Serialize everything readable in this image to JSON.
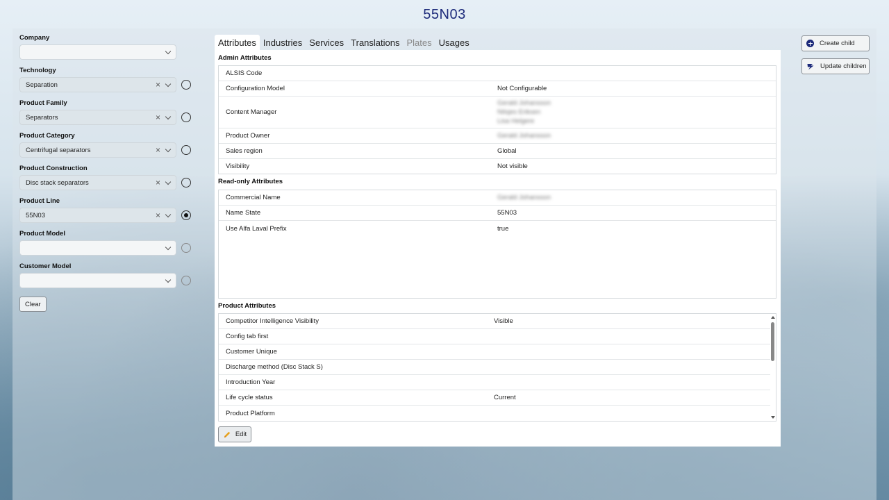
{
  "page": {
    "title": "55N03"
  },
  "filters": [
    {
      "label": "Company",
      "value": "",
      "clearable": false,
      "radio": "none"
    },
    {
      "label": "Technology",
      "value": "Separation",
      "clearable": true,
      "radio": "unchecked"
    },
    {
      "label": "Product Family",
      "value": "Separators",
      "clearable": true,
      "radio": "unchecked"
    },
    {
      "label": "Product Category",
      "value": "Centrifugal separators",
      "clearable": true,
      "radio": "unchecked"
    },
    {
      "label": "Product Construction",
      "value": "Disc stack separators",
      "clearable": true,
      "radio": "unchecked"
    },
    {
      "label": "Product Line",
      "value": "55N03",
      "clearable": true,
      "radio": "checked"
    },
    {
      "label": "Product Model",
      "value": "",
      "clearable": false,
      "radio": "dim"
    },
    {
      "label": "Customer Model",
      "value": "",
      "clearable": false,
      "radio": "dim"
    }
  ],
  "clear_label": "Clear",
  "tabs": [
    {
      "label": "Attributes",
      "state": "active"
    },
    {
      "label": "Industries",
      "state": "normal"
    },
    {
      "label": "Services",
      "state": "normal"
    },
    {
      "label": "Translations",
      "state": "normal"
    },
    {
      "label": "Plates",
      "state": "disabled"
    },
    {
      "label": "Usages",
      "state": "normal"
    }
  ],
  "admin": {
    "title": "Admin Attributes",
    "rows": [
      {
        "key": "ALSIS Code",
        "value": ""
      },
      {
        "key": "Configuration Model",
        "value": "Not Configurable"
      },
      {
        "key": "Content Manager",
        "value": "",
        "blurred_lines": 3
      },
      {
        "key": "Product Owner",
        "value": "",
        "blurred_lines": 1
      },
      {
        "key": "Sales region",
        "value": "Global"
      },
      {
        "key": "Visibility",
        "value": "Not visible"
      }
    ]
  },
  "readonly": {
    "title": "Read-only Attributes",
    "rows": [
      {
        "key": "Commercial Name",
        "value": "",
        "blurred_lines": 1
      },
      {
        "key": "Name State",
        "value": "55N03"
      },
      {
        "key": "Use Alfa Laval Prefix",
        "value": "true"
      }
    ]
  },
  "product": {
    "title": "Product Attributes",
    "rows": [
      {
        "key": "Competitor Intelligence Visibility",
        "value": "Visible"
      },
      {
        "key": "Config tab first",
        "value": ""
      },
      {
        "key": "Customer Unique",
        "value": ""
      },
      {
        "key": "Discharge method (Disc Stack S)",
        "value": ""
      },
      {
        "key": "Introduction Year",
        "value": ""
      },
      {
        "key": "Life cycle status",
        "value": "Current"
      },
      {
        "key": "Product Platform",
        "value": ""
      }
    ]
  },
  "edit_label": "Edit",
  "actions": {
    "create_child": "Create child",
    "update_children": "Update children"
  },
  "colors": {
    "title": "#1c2a7a",
    "accent_icon": "#1c2a7a",
    "pencil": "#e8a21a"
  }
}
